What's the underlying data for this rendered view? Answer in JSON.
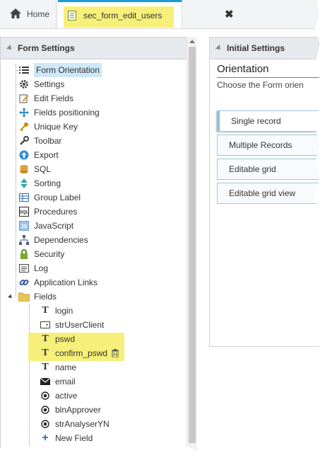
{
  "tabs": {
    "home_label": "Home",
    "active_label": "sec_form_edit_users",
    "close_glyph": "✖"
  },
  "left_panel": {
    "title": "Form Settings",
    "items": [
      {
        "label": "Form Orientation",
        "icon": "list-icon",
        "selected": true
      },
      {
        "label": "Settings",
        "icon": "gear-icon"
      },
      {
        "label": "Edit Fields",
        "icon": "edit-icon"
      },
      {
        "label": "Fields positioning",
        "icon": "move-icon"
      },
      {
        "label": "Unique Key",
        "icon": "key-icon"
      },
      {
        "label": "Toolbar",
        "icon": "wrench-icon"
      },
      {
        "label": "Export",
        "icon": "export-icon"
      },
      {
        "label": "SQL",
        "icon": "database-icon"
      },
      {
        "label": "Sorting",
        "icon": "sort-icon"
      },
      {
        "label": "Group Label",
        "icon": "table-icon"
      },
      {
        "label": "Procedures",
        "icon": "sql-icon"
      },
      {
        "label": "JavaScript",
        "icon": "js-icon"
      },
      {
        "label": "Dependencies",
        "icon": "hierarchy-icon"
      },
      {
        "label": "Security",
        "icon": "lock-icon"
      },
      {
        "label": "Log",
        "icon": "log-icon"
      },
      {
        "label": "Application Links",
        "icon": "link-icon"
      },
      {
        "label": "Fields",
        "icon": "folder-icon"
      }
    ],
    "fields": [
      {
        "label": "login",
        "icon": "text-icon"
      },
      {
        "label": "strUserClient",
        "icon": "select-icon"
      },
      {
        "label": "pswd",
        "icon": "text-icon"
      },
      {
        "label": "confirm_pswd",
        "icon": "text-icon"
      },
      {
        "label": "name",
        "icon": "text-icon"
      },
      {
        "label": "email",
        "icon": "email-icon"
      },
      {
        "label": "active",
        "icon": "radio-icon"
      },
      {
        "label": "blnApprover",
        "icon": "radio-icon"
      },
      {
        "label": "strAnalyserYN",
        "icon": "radio-icon"
      },
      {
        "label": "New Field",
        "icon": "plus-icon"
      }
    ]
  },
  "right_panel": {
    "title": "Initial Settings",
    "section_title": "Orientation",
    "description": "Choose the Form orien",
    "options": [
      "Single record",
      "Multiple Records",
      "Editable grid",
      "Editable grid view"
    ]
  },
  "colors": {
    "accent": "#1d9bd7",
    "highlight": "#f6f07a",
    "selected": "#cde8f6"
  }
}
